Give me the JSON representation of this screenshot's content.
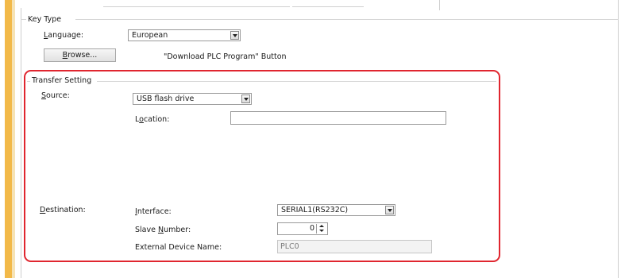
{
  "key_type": {
    "group_label": "Key Type",
    "language": {
      "label_u": "L",
      "label_rest": "anguage:",
      "value": "European"
    },
    "browse": {
      "label_u": "B",
      "label_rest": "rowse..."
    },
    "button_caption": "\"Download PLC Program\" Button"
  },
  "transfer_setting": {
    "group_label": "Transfer Setting",
    "source": {
      "label_u": "S",
      "label_rest": "ource:",
      "value": "USB flash drive"
    },
    "location": {
      "label_pre": "L",
      "label_u": "o",
      "label_rest": "cation:",
      "value": ""
    },
    "destination": {
      "label_u": "D",
      "label_rest": "estination:"
    },
    "interface": {
      "label_u": "I",
      "label_rest": "nterface:",
      "value": "SERIAL1(RS232C)"
    },
    "slave_number": {
      "label_pre": "Slave ",
      "label_u": "N",
      "label_rest": "umber:",
      "value": "0"
    },
    "external_device_name": {
      "label": "External Device Name:",
      "value": "PLC0"
    }
  },
  "colors": {
    "highlight": "#e0262f",
    "sidebar": "#f2b949"
  }
}
